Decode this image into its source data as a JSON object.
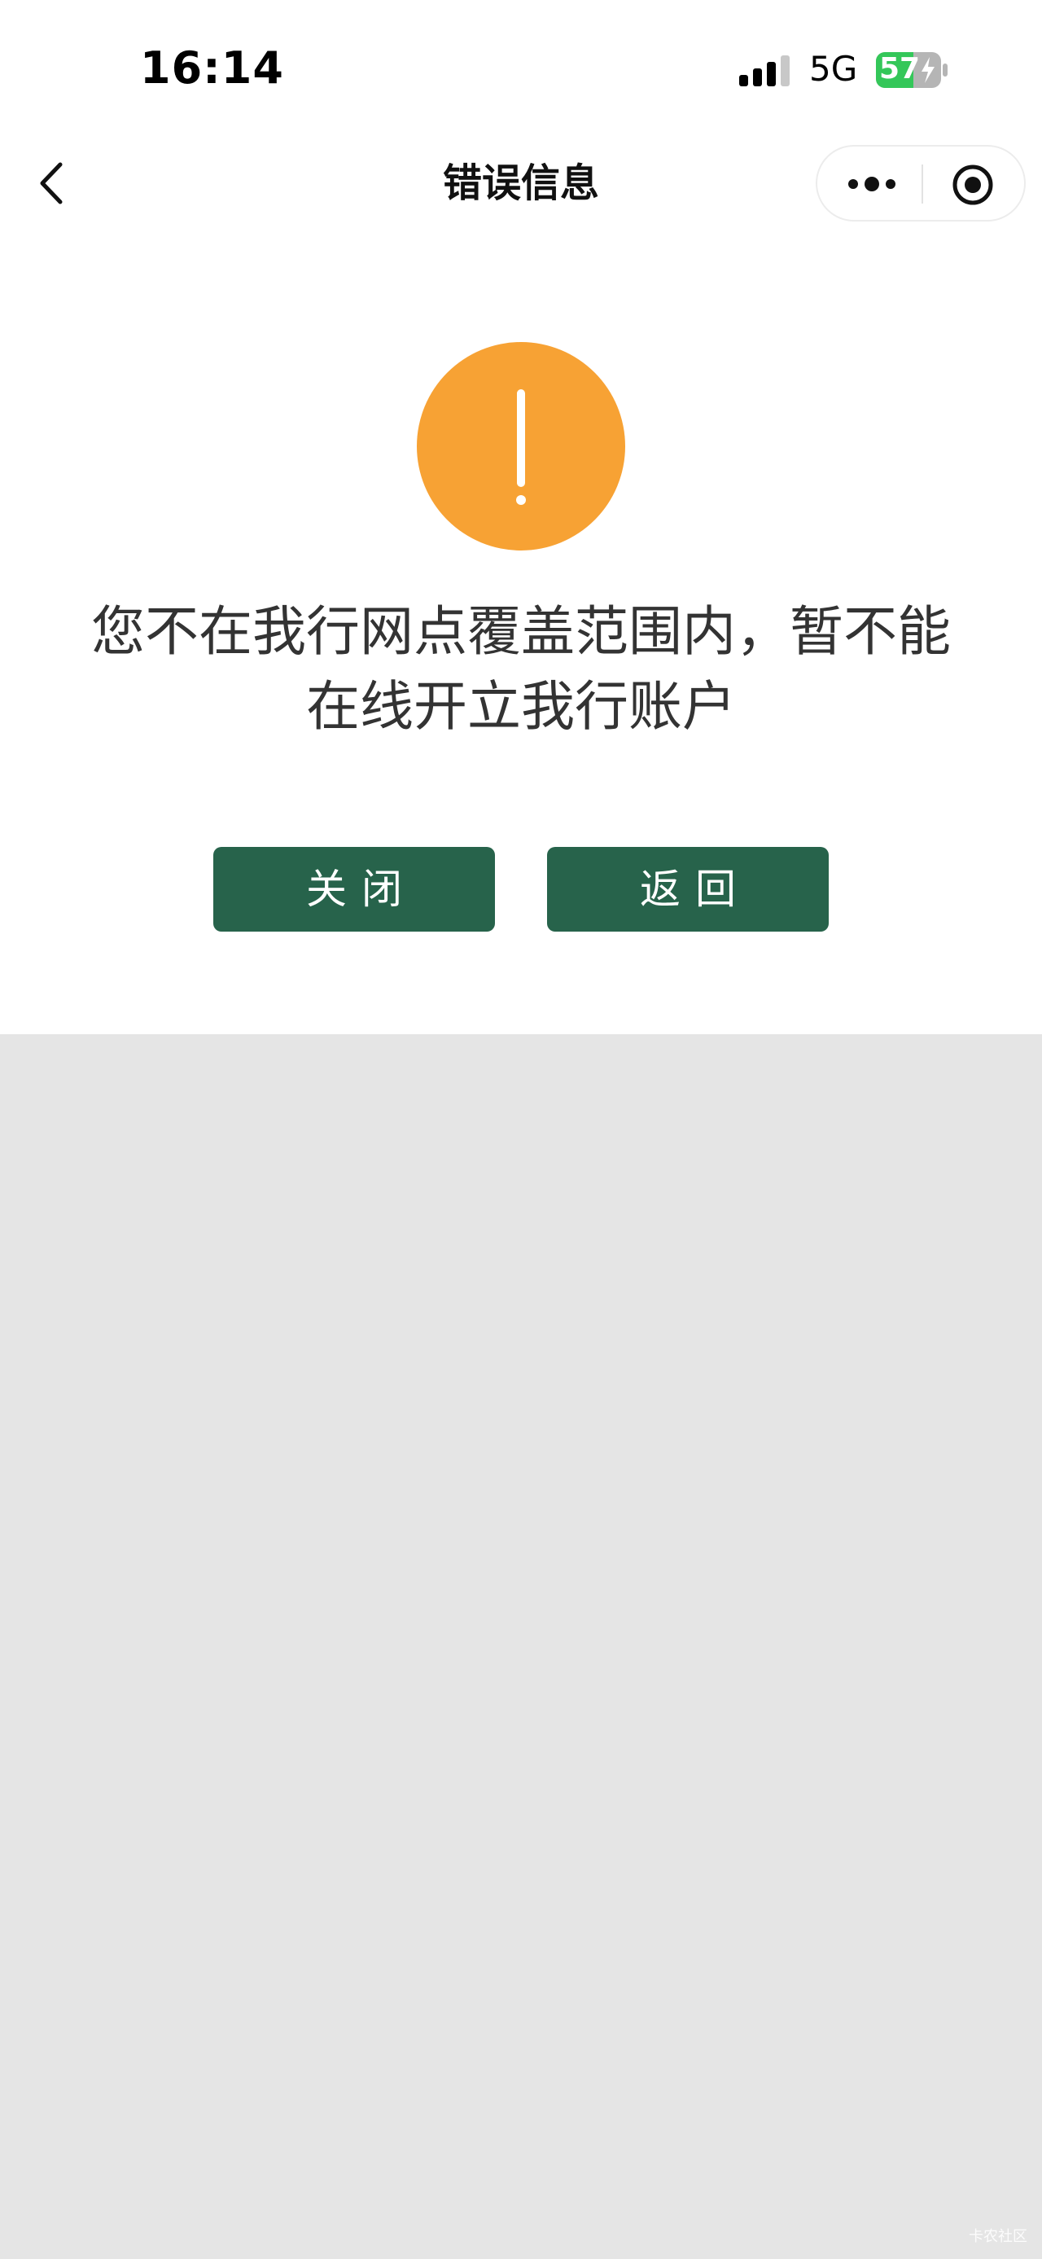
{
  "status_bar": {
    "time": "16:14",
    "network": "5G",
    "battery": "57"
  },
  "nav": {
    "title": "错误信息",
    "back_icon": "chevron-left-icon",
    "more_icon": "more-dots-icon",
    "close_icon": "target-circle-icon"
  },
  "alert": {
    "icon": "exclamation-icon",
    "icon_color": "#f7a234",
    "message_line1": "您不在我行网点覆盖范围内，暂不能",
    "message_line2": "在线开立我行账户"
  },
  "buttons": {
    "close_label": "关闭",
    "back_label": "返回",
    "color": "#27634b"
  },
  "watermark": "卡农社区"
}
